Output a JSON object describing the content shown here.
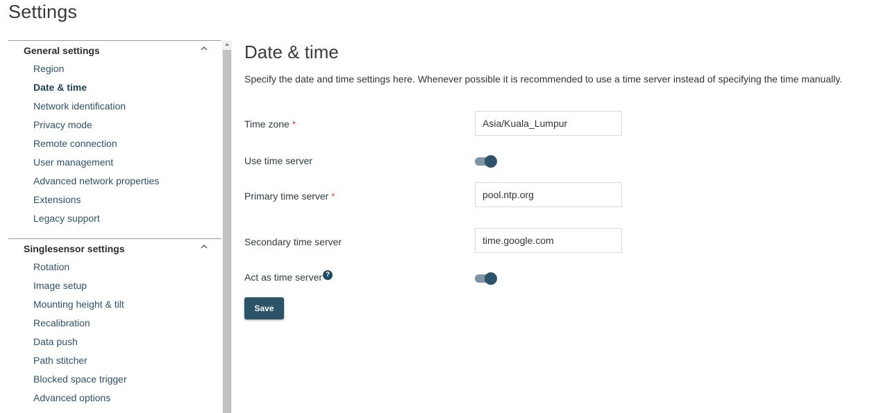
{
  "page_title": "Settings",
  "sidebar": {
    "sections": [
      {
        "title": "General settings",
        "items": [
          {
            "label": "Region"
          },
          {
            "label": "Date & time",
            "active": true
          },
          {
            "label": "Network identification"
          },
          {
            "label": "Privacy mode"
          },
          {
            "label": "Remote connection"
          },
          {
            "label": "User management"
          },
          {
            "label": "Advanced network properties"
          },
          {
            "label": "Extensions"
          },
          {
            "label": "Legacy support"
          }
        ]
      },
      {
        "title": "Singlesensor settings",
        "items": [
          {
            "label": "Rotation"
          },
          {
            "label": "Image setup"
          },
          {
            "label": "Mounting height & tilt"
          },
          {
            "label": "Recalibration"
          },
          {
            "label": "Data push"
          },
          {
            "label": "Path stitcher"
          },
          {
            "label": "Blocked space trigger"
          },
          {
            "label": "Advanced options"
          }
        ]
      }
    ]
  },
  "content": {
    "title": "Date & time",
    "description": "Specify the date and time settings here. Whenever possible it is recommended to use a time server instead of specifying the time manually.",
    "form": {
      "time_zone": {
        "label": "Time zone",
        "required_mark": "*",
        "value": "Asia/Kuala_Lumpur"
      },
      "use_time_server": {
        "label": "Use time server",
        "enabled": true
      },
      "primary_time_server": {
        "label": "Primary time server",
        "required_mark": "*",
        "value": "pool.ntp.org"
      },
      "secondary_time_server": {
        "label": "Secondary time server",
        "value": "time.google.com"
      },
      "act_as_time_server": {
        "label": "Act as time server",
        "help_glyph": "?",
        "enabled": true
      }
    },
    "save_label": "Save"
  },
  "icons": {
    "section_chevron": "chevron-up-icon",
    "help": "help-icon",
    "scroll_up": "arrow-up-icon"
  },
  "colors": {
    "accent": "#2c5368",
    "link": "#2f5166",
    "required": "#d9534f",
    "toggle_track": "#7c94a3"
  }
}
